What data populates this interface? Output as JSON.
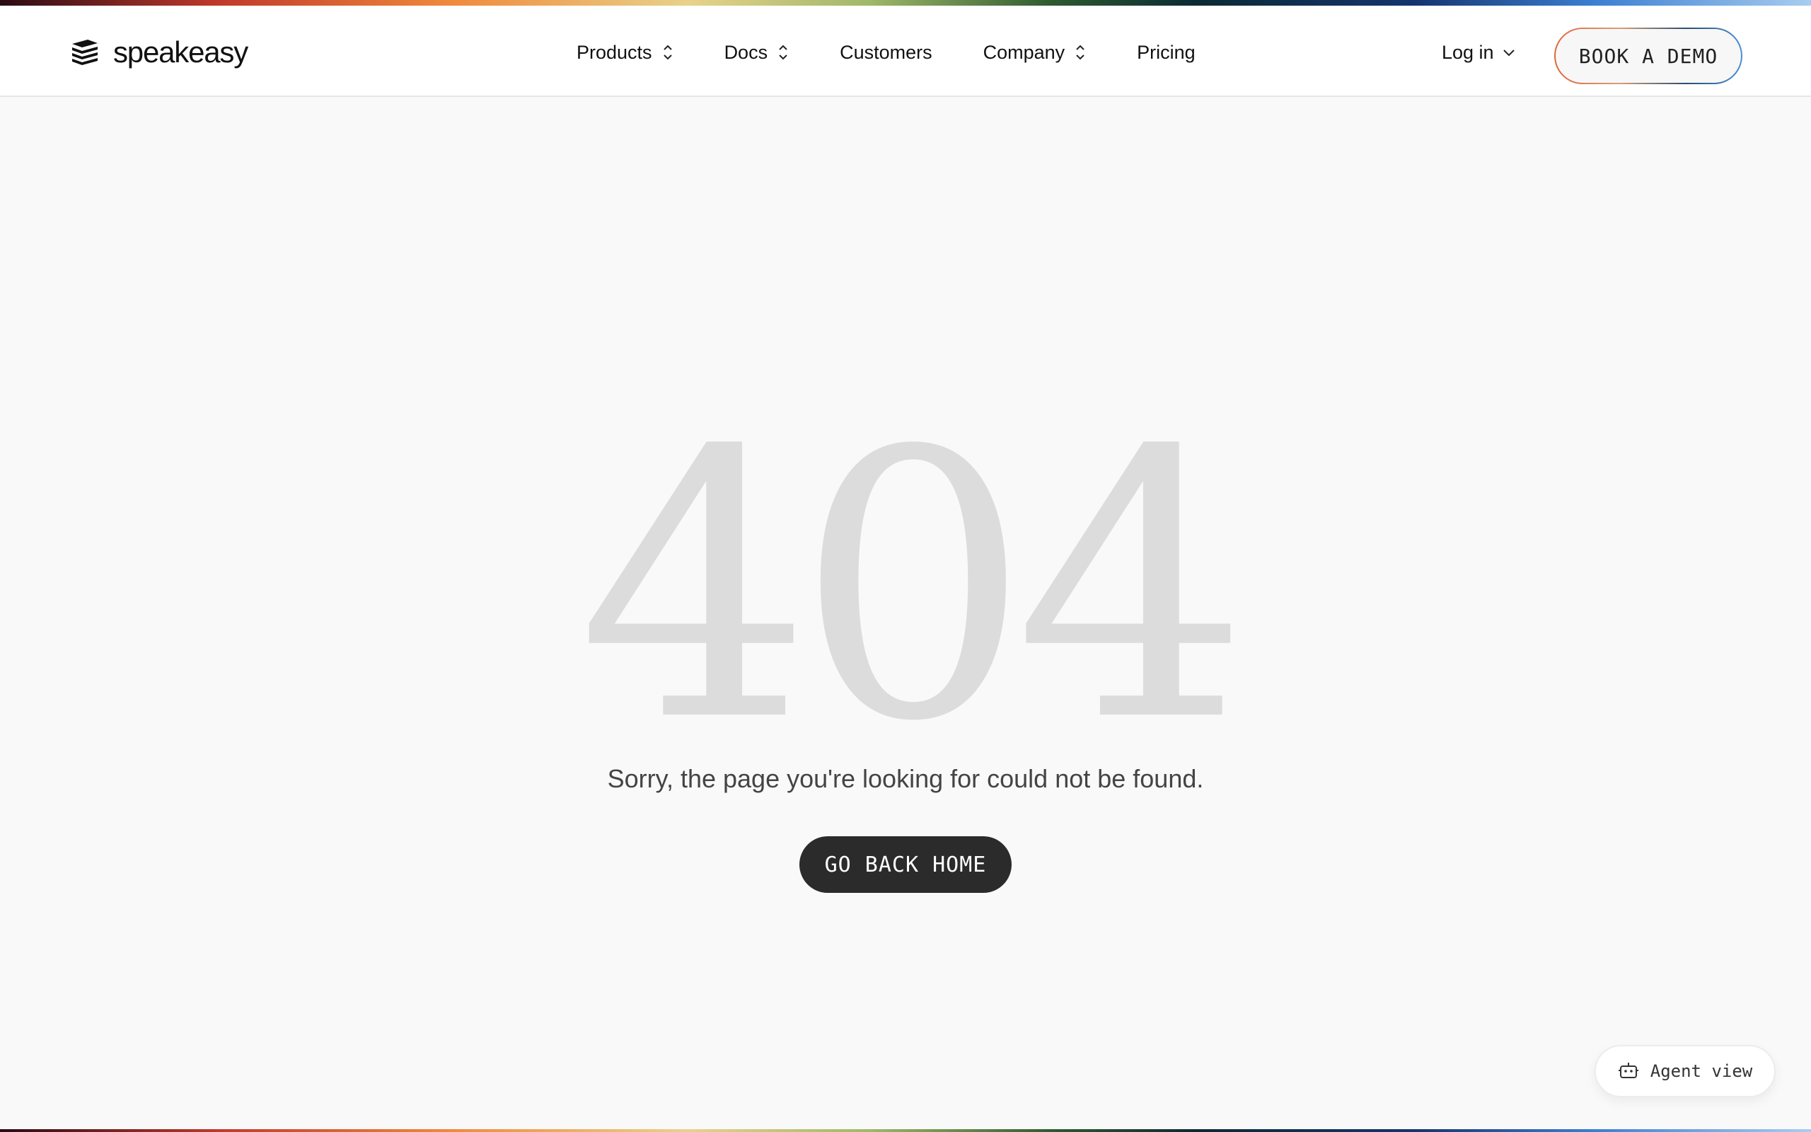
{
  "brand": {
    "name": "speakeasy",
    "logo_icon": "stacked-papers-icon"
  },
  "nav": {
    "items": [
      {
        "label": "Products",
        "icon": "chevron-up-down-icon"
      },
      {
        "label": "Docs",
        "icon": "chevron-up-down-icon"
      },
      {
        "label": "Customers"
      },
      {
        "label": "Company",
        "icon": "chevron-up-down-icon"
      },
      {
        "label": "Pricing"
      }
    ],
    "login_label": "Log in",
    "login_icon": "chevron-down-icon",
    "demo_label": "BOOK A DEMO"
  },
  "error": {
    "code": "404",
    "message": "Sorry, the page you're looking for could not be found.",
    "home_label": "GO BACK HOME"
  },
  "agent": {
    "label": "Agent view",
    "icon": "robot-icon"
  },
  "colors": {
    "background": "#f9f9f9",
    "header_background": "#ffffff",
    "code_text": "#dcdcdc",
    "primary_button": "#2b2b2b",
    "message_text": "#444444"
  }
}
